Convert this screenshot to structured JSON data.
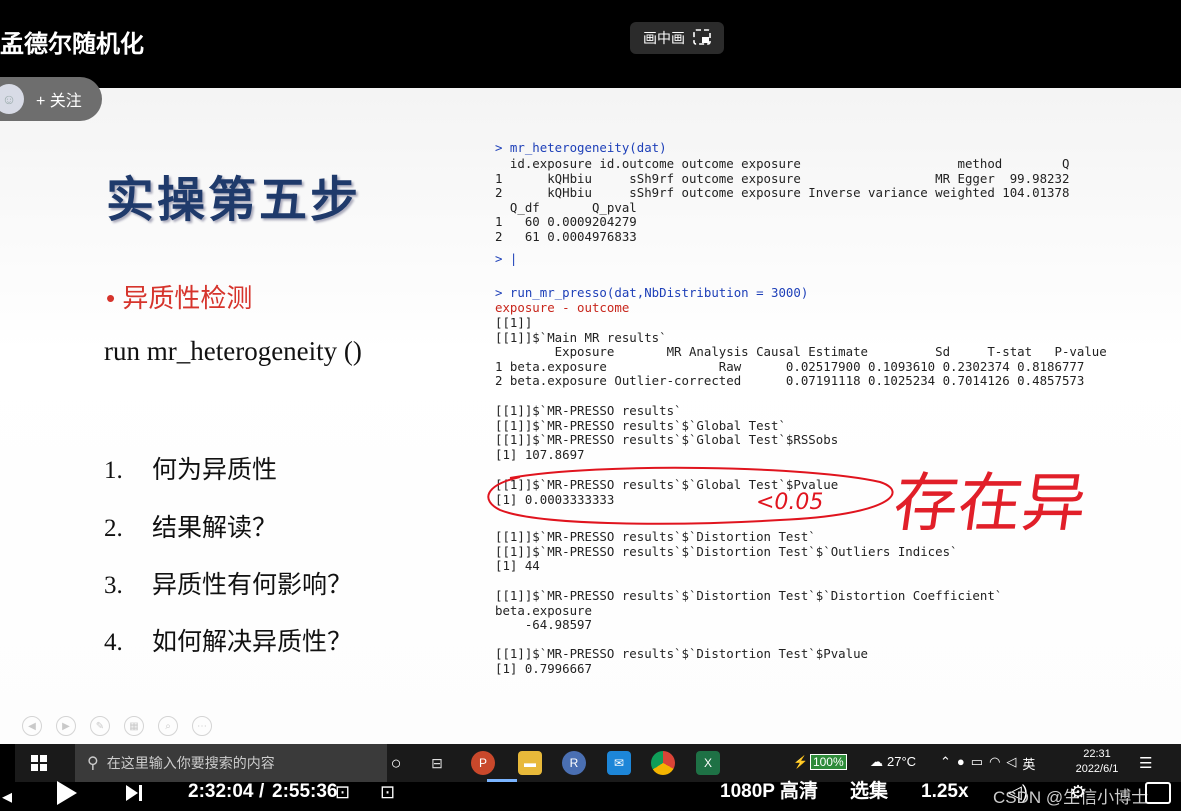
{
  "video": {
    "title": "孟德尔随机化",
    "pip_label": "画中画",
    "follow_label": "+ 关注"
  },
  "slide": {
    "heading": "实操第五步",
    "bullet": "• 异质性检测",
    "run_line": "run mr_heterogeneity ()",
    "questions": [
      {
        "num": "1.",
        "text": "何为异质性"
      },
      {
        "num": "2.",
        "text": "结果解读？"
      },
      {
        "num": "3.",
        "text": "异质性有何影响？"
      },
      {
        "num": "4.",
        "text": "如何解决异质性？"
      }
    ],
    "handwriting": {
      "note": "<0.05",
      "annotation": "存在异"
    }
  },
  "console": {
    "cmd1": "> mr_heterogeneity(dat)",
    "het_lines": [
      "  id.exposure id.outcome outcome exposure                     method        Q",
      "1      kQHbiu     sSh9rf outcome exposure                  MR Egger  99.98232",
      "2      kQHbiu     sSh9rf outcome exposure Inverse variance weighted 104.01378",
      "  Q_df       Q_pval",
      "1   60 0.0009204279",
      "2   61 0.0004976833"
    ],
    "prompt": "> |",
    "cmd2": "> run_mr_presso(dat,NbDistribution = 3000)",
    "red_line": "exposure - outcome",
    "presso_block1": [
      "[[1]]",
      "[[1]]$`Main MR results`",
      "        Exposure       MR Analysis Causal Estimate         Sd     T-stat   P-value",
      "1 beta.exposure               Raw      0.02517900 0.1093610 0.2302374 0.8186777",
      "2 beta.exposure Outlier-corrected      0.07191118 0.1025234 0.7014126 0.4857573"
    ],
    "presso_block2": [
      "[[1]]$`MR-PRESSO results`",
      "[[1]]$`MR-PRESSO results`$`Global Test`",
      "[[1]]$`MR-PRESSO results`$`Global Test`$RSSobs",
      "[1] 107.8697"
    ],
    "presso_block3": [
      "[[1]]$`MR-PRESSO results`$`Global Test`$Pvalue",
      "[1] 0.0003333333"
    ],
    "presso_block4": [
      "[[1]]$`MR-PRESSO results`$`Distortion Test`",
      "[[1]]$`MR-PRESSO results`$`Distortion Test`$`Outliers Indices`",
      "[1] 44"
    ],
    "presso_block5": [
      "[[1]]$`MR-PRESSO results`$`Distortion Test`$`Distortion Coefficient`",
      "beta.exposure ",
      "    -64.98597 "
    ],
    "presso_block6": [
      "[[1]]$`MR-PRESSO results`$`Distortion Test`$Pvalue",
      "[1] 0.7996667"
    ]
  },
  "taskbar": {
    "search_placeholder": "在这里输入你要搜索的内容",
    "battery": "100%",
    "weather": "27°C",
    "ime": "英",
    "time": "22:31",
    "date": "2022/6/1",
    "apps": [
      "task-view",
      "powerpoint",
      "file-explorer",
      "r-app",
      "mail",
      "chrome",
      "excel"
    ]
  },
  "player": {
    "current_time": "2:32:04",
    "separator": "/",
    "total_time": "2:55:36",
    "quality": "1080P 高清",
    "episodes": "选集",
    "speed": "1.25x",
    "watermark": "CSDN @生信小博士"
  },
  "colors": {
    "heading": "#1f3a6b",
    "bullet_red": "#d6342c",
    "console_blue": "#1d3fb8",
    "ink_red": "#e0141e"
  }
}
